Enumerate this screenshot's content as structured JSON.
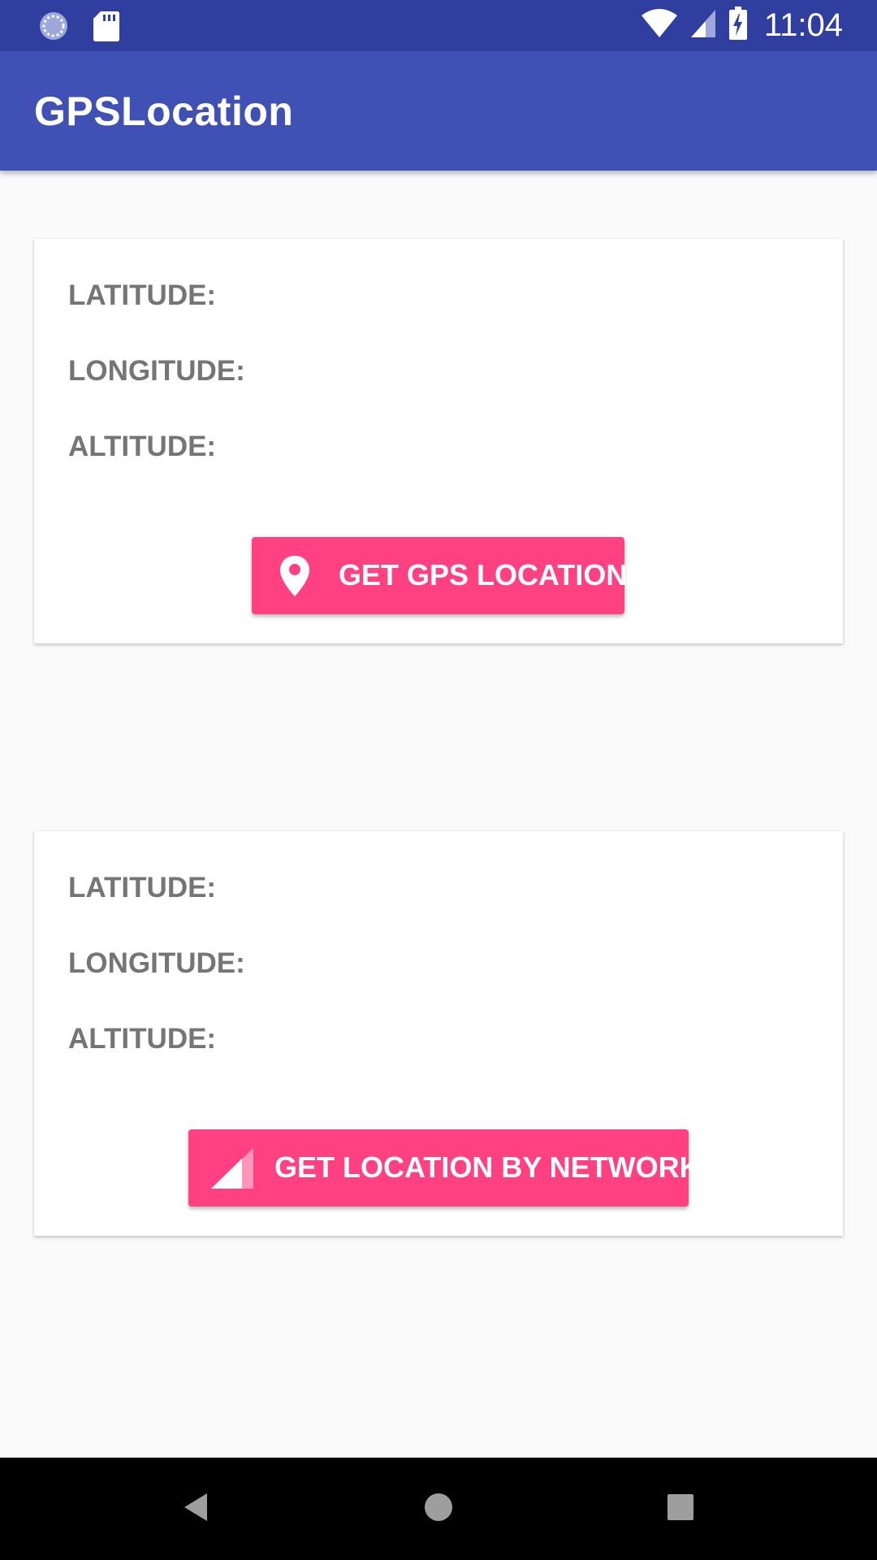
{
  "status_bar": {
    "time": "11:04",
    "left_icons": [
      "sync-icon",
      "sd-card-icon"
    ],
    "right_icons": [
      "wifi-icon",
      "cell-signal-icon",
      "battery-charging-icon"
    ]
  },
  "app_bar": {
    "title": "GPSLocation"
  },
  "gps_card": {
    "latitude_label": "LATITUDE:",
    "longitude_label": "LONGITUDE:",
    "altitude_label": "ALTITUDE:",
    "button_label": "GET GPS LOCATION",
    "button_icon": "location-pin-icon"
  },
  "network_card": {
    "latitude_label": "LATITUDE:",
    "longitude_label": "LONGITUDE:",
    "altitude_label": "ALTITUDE:",
    "button_label": "GET LOCATION BY NETWORK",
    "button_icon": "network-signal-icon"
  },
  "nav_bar": {
    "icons": [
      "back-icon",
      "home-icon",
      "recents-icon"
    ]
  },
  "colors": {
    "status_bar": "#303f9f",
    "app_bar": "#3f51b5",
    "accent": "#ff4081",
    "label_text": "#757575",
    "background": "#fafafa"
  }
}
